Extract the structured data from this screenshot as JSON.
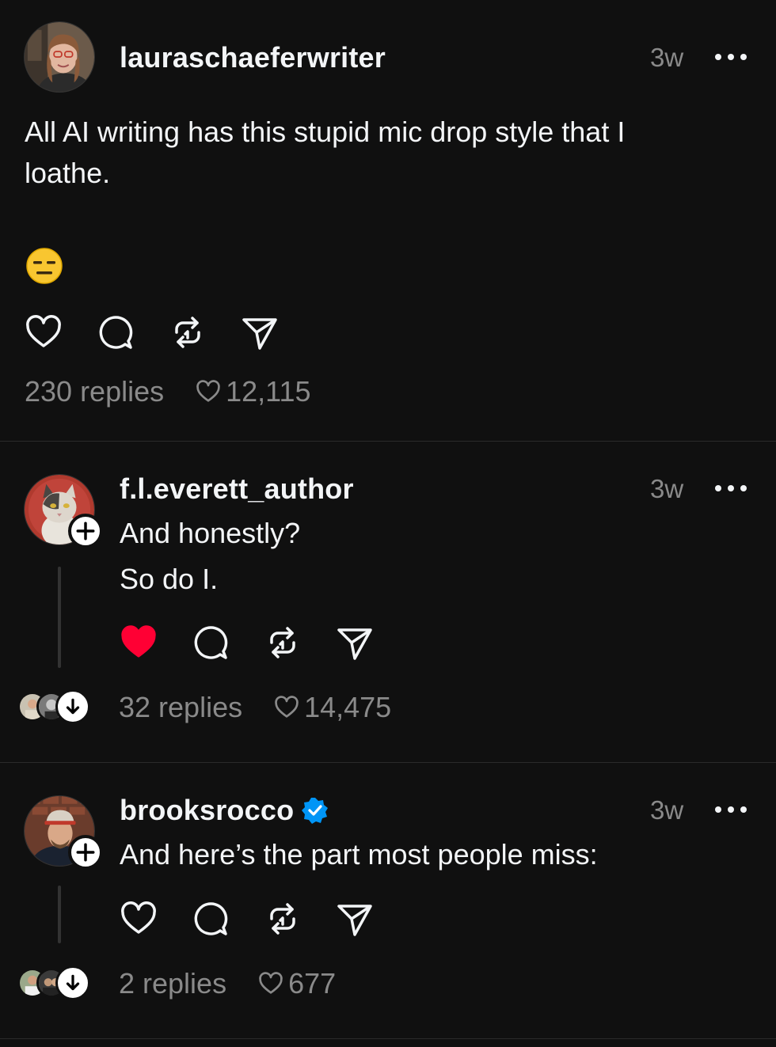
{
  "posts": [
    {
      "username": "lauraschaeferwriter",
      "time": "3w",
      "text_lines": [
        "All AI writing has this stupid mic drop style that I",
        "loathe."
      ],
      "emoji": "expressionless-face",
      "replies": "230 replies",
      "likes": "12,115",
      "liked": false
    },
    {
      "username": "f.l.everett_author",
      "time": "3w",
      "text_lines": [
        "And honestly?",
        "So do I."
      ],
      "replies": "32 replies",
      "likes": "14,475",
      "liked": true
    },
    {
      "username": "brooksrocco",
      "verified": true,
      "time": "3w",
      "text_lines": [
        "And here’s the part most people miss:"
      ],
      "replies": "2 replies",
      "likes": "677",
      "liked": false
    }
  ],
  "icons": {
    "like": "heart-icon",
    "comment": "comment-bubble-icon",
    "repost": "repost-icon",
    "share": "share-send-icon",
    "more": "more-dots-icon",
    "follow": "plus-icon",
    "expand_replies": "arrow-down-icon",
    "verified": "verified-badge-icon"
  },
  "colors": {
    "background": "#101010",
    "text": "#f3f5f7",
    "muted": "#8a8a8a",
    "liked_red": "#ff0034",
    "verified_blue": "#0095f6"
  }
}
